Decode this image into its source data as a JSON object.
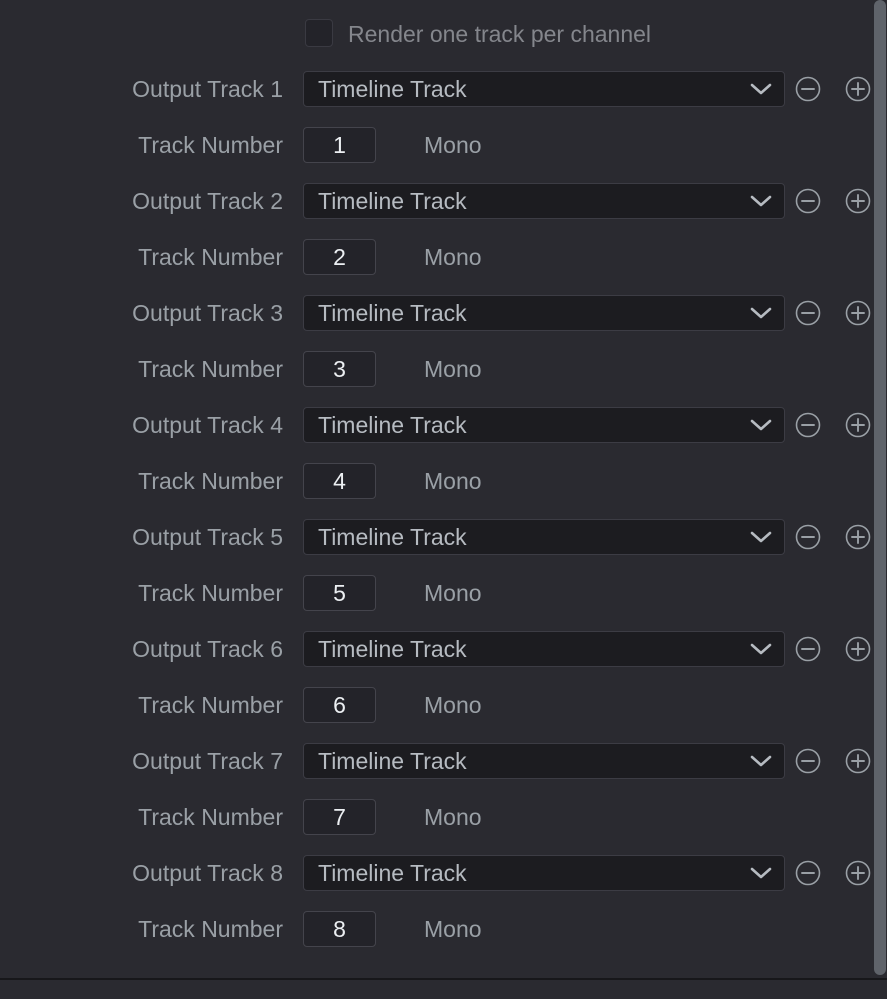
{
  "panel": {
    "name": "audio-output-track-settings",
    "background_color": "#2a2a30",
    "label_color": "#9aa0a6",
    "value_color": "#b6bbc1",
    "field_background": "#1c1c20",
    "scrollbar_color": "#5f636a"
  },
  "render_per_channel": {
    "label": "Render one track per channel",
    "checked": false
  },
  "icons": {
    "chevron_down": "chevron-down-icon",
    "minus_circle": "minus-circle-icon",
    "plus_circle": "plus-circle-icon",
    "checkbox": "checkbox-icon"
  },
  "labels": {
    "track_number": "Track Number",
    "mono": "Mono",
    "remove": "Remove output track",
    "add": "Add output track"
  },
  "tracks": [
    {
      "output_label": "Output Track 1",
      "source": "Timeline Track",
      "track_number": "1",
      "channel_format": "Mono"
    },
    {
      "output_label": "Output Track 2",
      "source": "Timeline Track",
      "track_number": "2",
      "channel_format": "Mono"
    },
    {
      "output_label": "Output Track 3",
      "source": "Timeline Track",
      "track_number": "3",
      "channel_format": "Mono"
    },
    {
      "output_label": "Output Track 4",
      "source": "Timeline Track",
      "track_number": "4",
      "channel_format": "Mono"
    },
    {
      "output_label": "Output Track 5",
      "source": "Timeline Track",
      "track_number": "5",
      "channel_format": "Mono"
    },
    {
      "output_label": "Output Track 6",
      "source": "Timeline Track",
      "track_number": "6",
      "channel_format": "Mono"
    },
    {
      "output_label": "Output Track 7",
      "source": "Timeline Track",
      "track_number": "7",
      "channel_format": "Mono"
    },
    {
      "output_label": "Output Track 8",
      "source": "Timeline Track",
      "track_number": "8",
      "channel_format": "Mono"
    }
  ]
}
